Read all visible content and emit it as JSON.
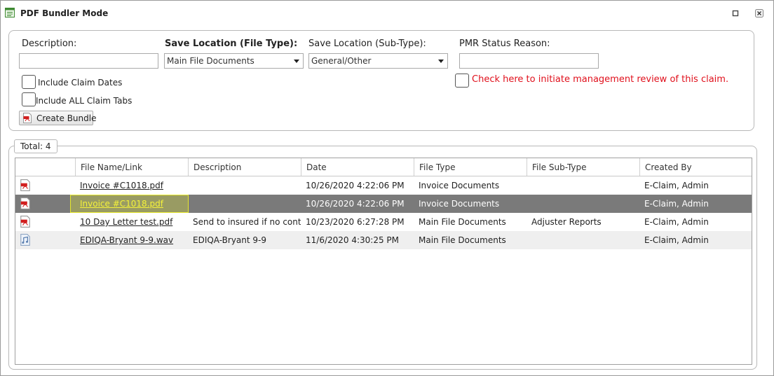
{
  "window": {
    "title": "PDF Bundler Mode",
    "icon": "form-window-icon",
    "maximize_icon": "maximize-icon",
    "close_icon": "close-icon"
  },
  "form": {
    "description_label": "Description:",
    "description_value": "",
    "file_type_label": "Save Location (File Type):",
    "file_type_value": "Main File Documents",
    "sub_type_label": "Save Location (Sub-Type):",
    "sub_type_value": "General/Other",
    "pmr_label": "PMR Status Reason:",
    "pmr_value": "",
    "include_claim_dates_label": "Include Claim Dates",
    "include_all_tabs_label": "Include ALL Claim Tabs",
    "review_label": "Check here to initiate management review of this claim.",
    "create_bundle_label": "Create Bundle",
    "accent_red": "#e0101c"
  },
  "grid": {
    "total_label": "Total: 4",
    "columns": [
      "",
      "File Name/Link",
      "Description",
      "Date",
      "File Type",
      "File Sub-Type",
      "Created By"
    ],
    "rows": [
      {
        "icon": "pdf-icon",
        "file": "Invoice #C1018.pdf",
        "description": "",
        "date": "10/26/2020 4:22:06 PM",
        "file_type": "Invoice Documents",
        "sub_type": "",
        "created_by": "E-Claim, Admin"
      },
      {
        "icon": "pdf-icon",
        "file": "Invoice #C1018.pdf",
        "description": "",
        "date": "10/26/2020 4:22:06 PM",
        "file_type": "Invoice Documents",
        "sub_type": "",
        "created_by": "E-Claim, Admin"
      },
      {
        "icon": "pdf-icon",
        "file": "10 Day Letter test.pdf",
        "description": "Send to insured if no contact",
        "date": "10/23/2020 6:27:28 PM",
        "file_type": "Main File Documents",
        "sub_type": "Adjuster Reports",
        "created_by": "E-Claim, Admin"
      },
      {
        "icon": "audio-file-icon",
        "file": "EDIQA-Bryant 9-9.wav",
        "description": "EDIQA-Bryant 9-9",
        "date": "11/6/2020 4:30:25 PM",
        "file_type": "Main File Documents",
        "sub_type": "",
        "created_by": "E-Claim, Admin"
      }
    ],
    "selected_row_color": "#7a7a7a",
    "highlight_color": "#f4f23a"
  }
}
